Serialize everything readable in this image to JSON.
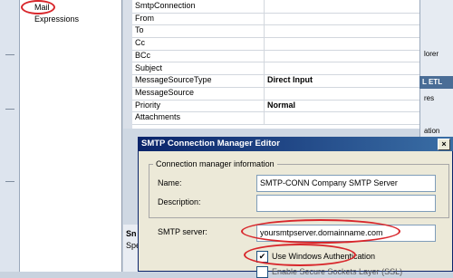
{
  "nav": {
    "mail": "Mail",
    "expressions": "Expressions"
  },
  "grid": {
    "rows": [
      {
        "name": "SmtpConnection",
        "value": ""
      },
      {
        "name": "From",
        "value": ""
      },
      {
        "name": "To",
        "value": ""
      },
      {
        "name": "Cc",
        "value": ""
      },
      {
        "name": "BCc",
        "value": ""
      },
      {
        "name": "Subject",
        "value": ""
      },
      {
        "name": "MessageSourceType",
        "value": "Direct Input"
      },
      {
        "name": "MessageSource",
        "value": ""
      },
      {
        "name": "Priority",
        "value": "Normal"
      },
      {
        "name": "Attachments",
        "value": ""
      }
    ]
  },
  "right_pane": {
    "t1": "lorer",
    "t2": "L ETL",
    "t3": "res",
    "t4": "ation"
  },
  "below": {
    "s1": "Sn",
    "s2": "Spe"
  },
  "dialog": {
    "title": "SMTP Connection Manager Editor",
    "close": "×",
    "group_title": "Connection manager information",
    "name_label": "Name:",
    "name_value": "SMTP-CONN Company SMTP Server",
    "desc_label": "Description:",
    "desc_value": "",
    "server_label": "SMTP server:",
    "server_value": "yoursmtpserver.domainname.com",
    "win_auth_label": "Use Windows Authentication",
    "win_auth_checked": "✔",
    "ssl_label": "Enable Secure Sockets Layer (SSL)"
  }
}
